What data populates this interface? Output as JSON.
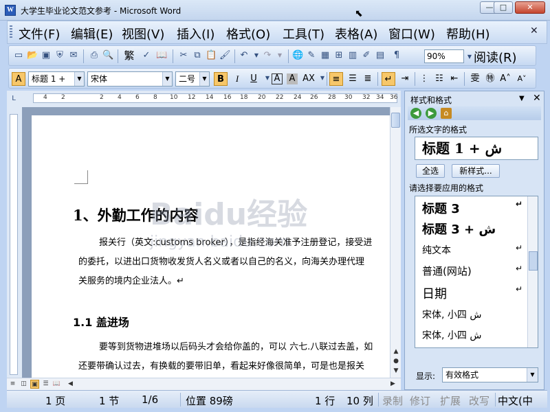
{
  "window": {
    "title": "大学生毕业论文范文参考 - Microsoft Word",
    "app_icon": "W",
    "minimize_label": "—",
    "maximize_label": "□",
    "close_label": "✕"
  },
  "menubar": {
    "items": [
      "文件(F)",
      "编辑(E)",
      "视图(V)",
      "插入(I)",
      "格式(O)",
      "工具(T)",
      "表格(A)",
      "窗口(W)",
      "帮助(H)"
    ],
    "close_label": "✕"
  },
  "standard_toolbar": {
    "icons": [
      "new-icon",
      "open-icon",
      "save-icon",
      "permission-icon",
      "email-icon",
      "print-icon",
      "print-preview-icon",
      "traditional-chinese-icon",
      "spelling-icon",
      "research-icon",
      "cut-icon",
      "copy-icon",
      "paste-icon",
      "format-painter-icon",
      "undo-icon",
      "redo-icon",
      "hyperlink-icon",
      "tables-borders-icon",
      "insert-table-icon",
      "insert-excel-icon",
      "drawing-icon",
      "show-hide-icon"
    ],
    "trad_label": "繁",
    "zoom_value": "90%",
    "read_label": "阅读(R)"
  },
  "formatting_toolbar": {
    "style_value": "标题 1 +",
    "font_value": "宋体",
    "size_value": "二号",
    "bold_label": "B",
    "italic_label": "I",
    "underline_label": "U"
  },
  "ruler": {
    "numbers": [
      "4",
      "2",
      "2",
      "4",
      "6",
      "8",
      "10",
      "12",
      "14",
      "16",
      "18",
      "20",
      "22",
      "24",
      "26",
      "28",
      "30",
      "32",
      "34",
      "36"
    ]
  },
  "document": {
    "heading1": "1、外勤工作的内容",
    "para1": [
      "报关行（英文:customs broker），是指经海关准予注册登记，接受进",
      "的委托，以进出口货物收发货人名义或者以自己的名义，向海关办理代理",
      "关服务的境内企业法人。↵"
    ],
    "heading2": "1.1 盖进场",
    "para2": [
      "要等到货物进堆场以后码头才会给你盖的，可以 六七.八联过去盖，如",
      "还要带确认过去，有换载的要带旧单，看起来好像很简单，可是也是报关"
    ]
  },
  "taskpane": {
    "title": "样式和格式",
    "selected_label": "所选文字的格式",
    "current_style": "标题  1 + ش",
    "select_all_label": "全选",
    "new_style_label": "新样式...",
    "apply_label": "请选择要应用的格式",
    "styles": [
      {
        "name": "标题  3",
        "style": "bold"
      },
      {
        "name": "标题  3 + ش",
        "style": "bold"
      },
      {
        "name": "纯文本",
        "style": "normal"
      },
      {
        "name": "普通(网站)",
        "style": "normal"
      },
      {
        "name": " 日期",
        "style": "large"
      },
      {
        "name": "宋体, 小四 ش",
        "style": "normal"
      },
      {
        "name": "宋体, 小四 ش",
        "style": "normal"
      }
    ],
    "show_label": "显示:",
    "show_value": "有效格式"
  },
  "statusbar": {
    "page": "1 页",
    "section": "1 节",
    "page_of": "1/6",
    "position": "位置 89磅",
    "line": "1 行",
    "column": "10 列",
    "rec": "录制",
    "trk": "修订",
    "ext": "扩展",
    "ovr": "改写",
    "language": "中文(中"
  },
  "watermark": {
    "main": "Baidu经验",
    "sub": "jingyan.baidu.com"
  }
}
